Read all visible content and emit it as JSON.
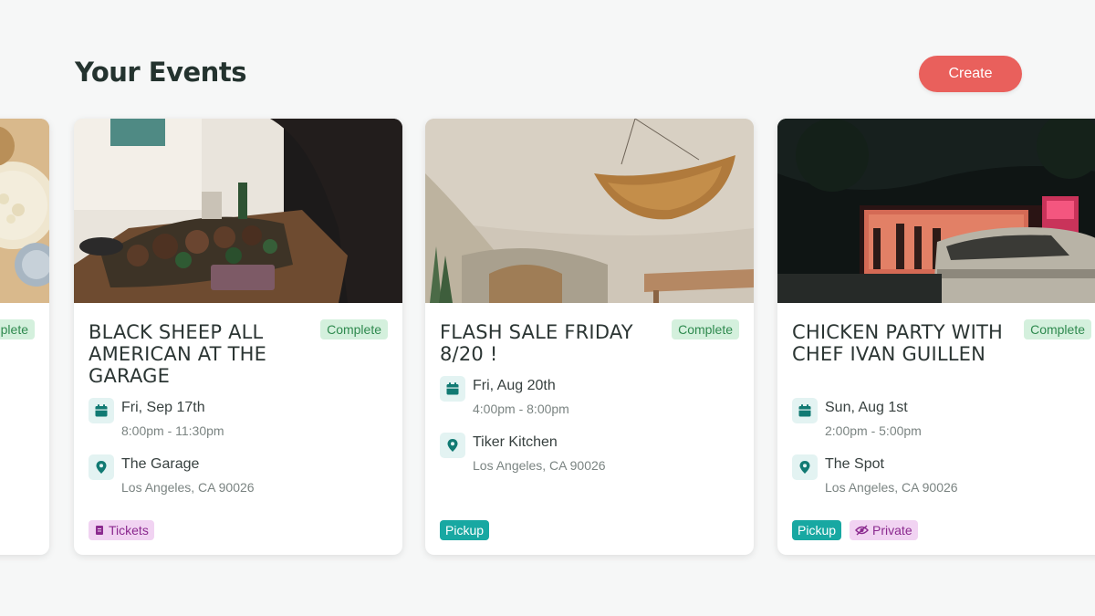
{
  "header": {
    "title": "Your Events",
    "create_label": "Create"
  },
  "colors": {
    "accent": "#e9605c",
    "teal": "#18a8a2",
    "complete_bg": "#d4f0dd",
    "tag_purple_bg": "#f1d3f2"
  },
  "partial_card": {
    "status": "Complete"
  },
  "events": [
    {
      "title": "BLACK SHEEP ALL AMERICAN AT THE GARAGE",
      "status": "Complete",
      "date": "Fri, Sep 17th",
      "time": "8:00pm - 11:30pm",
      "venue": "The Garage",
      "address": "Los Angeles, CA 90026",
      "tags": [
        "Tickets"
      ],
      "image": "food-spread-photo"
    },
    {
      "title": "FLASH SALE FRIDAY 8/20 !",
      "status": "Complete",
      "date": "Fri, Aug 20th",
      "time": "4:00pm - 8:00pm",
      "venue": "Tiker Kitchen",
      "address": "Los Angeles, CA 90026",
      "tags": [
        "Pickup"
      ],
      "image": "hanging-basket-photo"
    },
    {
      "title": "CHICKEN PARTY WITH CHEF IVAN GUILLEN",
      "status": "Complete",
      "date": "Sun, Aug 1st",
      "time": "2:00pm - 5:00pm",
      "venue": "The Spot",
      "address": "Los Angeles, CA 90026",
      "tags": [
        "Pickup",
        "Private"
      ],
      "image": "night-garage-party-photo"
    }
  ]
}
